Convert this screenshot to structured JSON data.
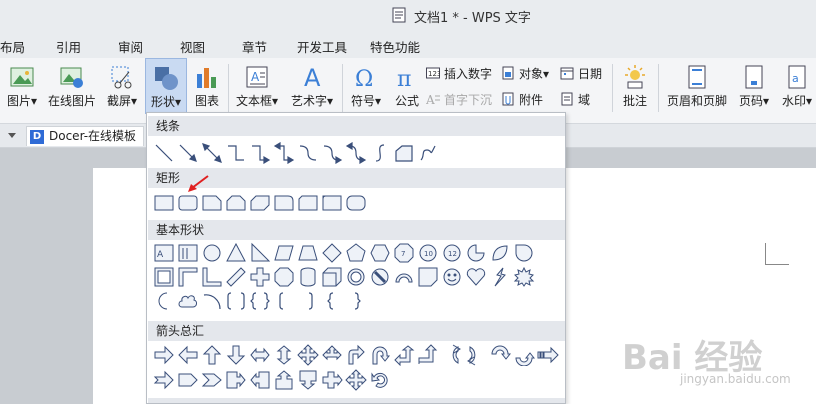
{
  "titlebar": {
    "title": "文档1 * - WPS 文字"
  },
  "menu": {
    "tabs": [
      {
        "label": "布局"
      },
      {
        "label": "引用"
      },
      {
        "label": "审阅"
      },
      {
        "label": "视图"
      },
      {
        "label": "章节"
      },
      {
        "label": "开发工具"
      },
      {
        "label": "特色功能"
      }
    ]
  },
  "ribbon": {
    "picture": "图片▾",
    "online_picture": "在线图片",
    "screenshot": "截屏▾",
    "shape": "形状▾",
    "chart": "图表",
    "textbox": "文本框▾",
    "wordart": "艺术字▾",
    "symbol": "符号▾",
    "formula": "公式",
    "insert_number": "插入数字",
    "object": "对象▾",
    "date": "日期",
    "dropcap": "首字下沉",
    "attachment": "附件",
    "field": "域",
    "comment": "批注",
    "header_footer": "页眉和页脚",
    "page_number": "页码▾",
    "watermark": "水印▾"
  },
  "toolbar": {
    "docer_tab": "Docer-在线模板"
  },
  "dropdown": {
    "sections": [
      {
        "title": "线条"
      },
      {
        "title": "矩形"
      },
      {
        "title": "基本形状"
      },
      {
        "title": "箭头总汇"
      }
    ]
  },
  "watermark": {
    "brand": "Bai 经验",
    "url": "jingyan.baidu.com"
  },
  "colors": {
    "accent_active": "#c9daf2",
    "shape_stroke": "#3a4f7a",
    "arrow_red": "#e02020"
  }
}
